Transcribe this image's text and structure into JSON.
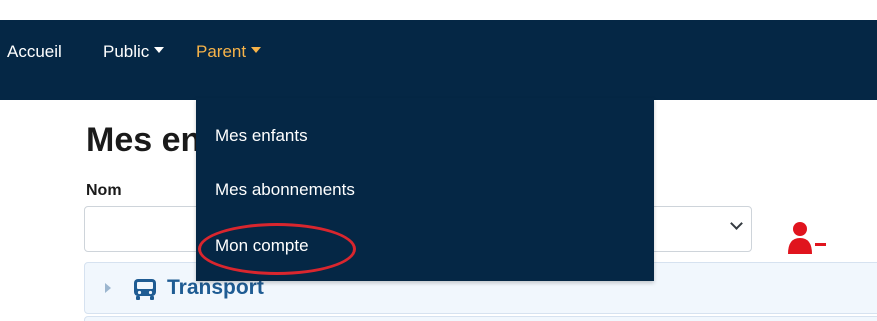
{
  "nav": {
    "home": "Accueil",
    "public": "Public",
    "parent": "Parent",
    "active_color": "#f7b349",
    "background": "#052745"
  },
  "dropdown": {
    "items": [
      "Mes enfants",
      "Mes abonnements",
      "Mon compte"
    ],
    "highlighted": "Mon compte",
    "highlight_color": "#d9262e"
  },
  "page": {
    "title": "Mes en",
    "field_label": "Nom",
    "select_value": "",
    "remove_icon": "user-minus-icon",
    "remove_color": "#e0141e"
  },
  "accordion": {
    "label": "Transport",
    "icon": "bus-icon",
    "expand_icon": "caret-right-icon"
  }
}
